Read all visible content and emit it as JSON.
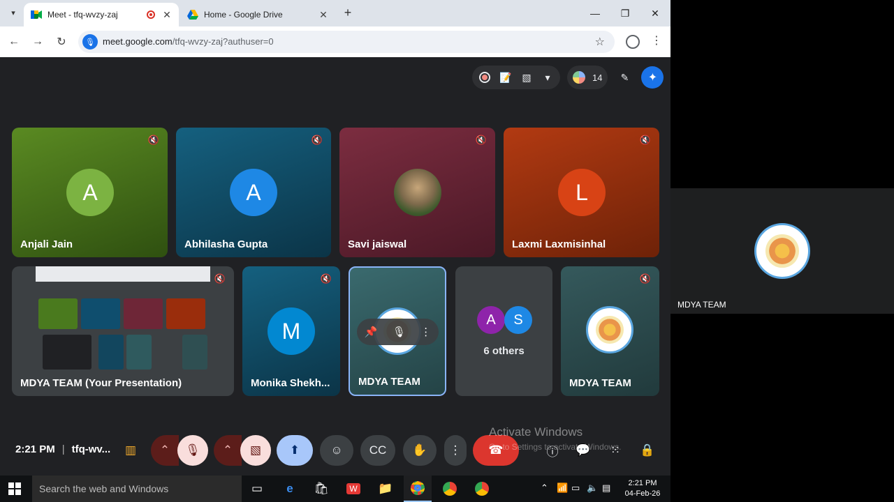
{
  "browser": {
    "tabs": [
      {
        "title": "Meet - tfq-wvzy-zaj",
        "active": true
      },
      {
        "title": "Home - Google Drive",
        "active": false
      }
    ],
    "url_host": "meet.google.com",
    "url_path": "/tfq-wvzy-zaj?authuser=0"
  },
  "meet": {
    "participant_count": "14",
    "tiles": [
      {
        "name": "Anjali Jain",
        "initial": "A",
        "bg": "#4a7a1e",
        "avatar_color": "#7cb342"
      },
      {
        "name": "Abhilasha Gupta",
        "initial": "A",
        "bg": "#0f4e6e",
        "avatar_color": "#1e88e5"
      },
      {
        "name": "Savi jaiswal",
        "initial": "",
        "bg": "#6e2637",
        "avatar_color": ""
      },
      {
        "name": "Laxmi Laxmisinhal",
        "initial": "L",
        "bg": "#9a2d0c",
        "avatar_color": "#d84315"
      },
      {
        "name": "MDYA TEAM (Your Presentation)",
        "initial": "",
        "bg": "#3c4043"
      },
      {
        "name": "Monika Shekh...",
        "initial": "M",
        "bg": "#12465e",
        "avatar_color": "#0288d1"
      },
      {
        "name": "MDYA TEAM",
        "initial": "",
        "bg": "#2f5a5e"
      },
      {
        "name": "MDYA TEAM",
        "initial": "",
        "bg": "#2f4f52"
      }
    ],
    "others": {
      "label": "6 others",
      "a": "A",
      "s": "S",
      "a_color": "#8e24aa",
      "s_color": "#1e88e5"
    },
    "time": "2:21 PM",
    "meeting_code": "tfq-wv..."
  },
  "watermark": {
    "title": "Activate Windows",
    "subtitle": "Go to Settings to activate Windows."
  },
  "side_panel": {
    "name": "MDYA TEAM"
  },
  "taskbar": {
    "search_placeholder": "Search the web and Windows",
    "clock_time": "2:21 PM",
    "clock_date": "04-Feb-26"
  }
}
